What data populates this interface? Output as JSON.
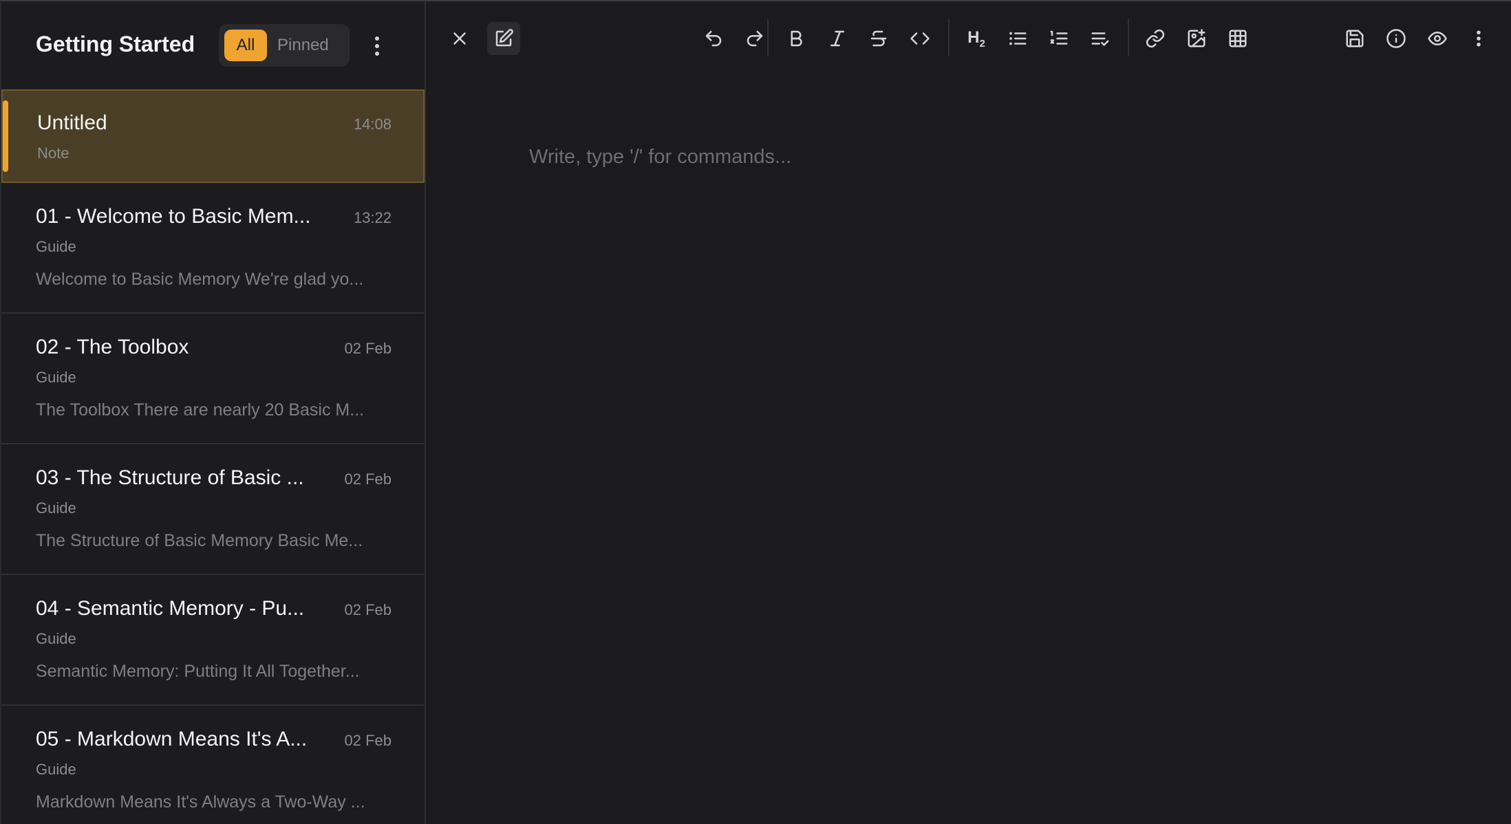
{
  "sidebar": {
    "title": "Getting Started",
    "filter_all": "All",
    "filter_pinned": "Pinned",
    "notes": [
      {
        "title": "Untitled",
        "time": "14:08",
        "type": "Note",
        "snippet": ""
      },
      {
        "title": "01 - Welcome to Basic Mem...",
        "time": "13:22",
        "type": "Guide",
        "snippet": "Welcome to Basic Memory We're glad yo..."
      },
      {
        "title": "02 - The Toolbox",
        "time": "02 Feb",
        "type": "Guide",
        "snippet": "The Toolbox There are nearly 20 Basic M..."
      },
      {
        "title": "03 - The Structure of Basic ...",
        "time": "02 Feb",
        "type": "Guide",
        "snippet": "The Structure of Basic Memory Basic Me..."
      },
      {
        "title": "04 - Semantic Memory - Pu...",
        "time": "02 Feb",
        "type": "Guide",
        "snippet": "Semantic Memory: Putting It All Together..."
      },
      {
        "title": "05 - Markdown Means It's A...",
        "time": "02 Feb",
        "type": "Guide",
        "snippet": "Markdown Means It's Always a Two-Way ..."
      }
    ]
  },
  "toolbar": {
    "heading_label": "H",
    "heading_level": "2"
  },
  "editor": {
    "placeholder": "Write, type '/' for commands..."
  },
  "colors": {
    "accent": "#f0a430",
    "background": "#1b1b1d",
    "active_note_bg": "#4a3e26"
  }
}
